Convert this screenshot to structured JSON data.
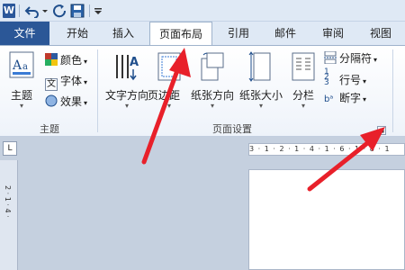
{
  "tabs": {
    "file": "文件",
    "home": "开始",
    "insert": "插入",
    "page_layout": "页面布局",
    "references": "引用",
    "mailings": "邮件",
    "review": "审阅",
    "view": "视图"
  },
  "ribbon": {
    "themes_group": {
      "label": "主题",
      "themes": "主题",
      "colors": "颜色",
      "fonts": "字体",
      "effects": "效果"
    },
    "page_setup_group": {
      "label": "页面设置",
      "text_direction": "文字方向",
      "margins": "页边距",
      "orientation": "纸张方向",
      "size": "纸张大小",
      "columns": "分栏",
      "breaks": "分隔符",
      "line_numbers": "行号",
      "hyphenation": "断字"
    }
  },
  "ruler": {
    "horizontal_ticks": "3 · 1 · 2 · 1 · 4 · 1 · 6 · 1 · 8 · 1",
    "vertical_ticks": "2 · 1 · 4 ·"
  },
  "colors": {
    "accent_arrow": "#e8202a",
    "file_tab": "#2b5797",
    "ribbon_bg": "#dfe9f5"
  },
  "icons": [
    "word-logo-icon",
    "undo-icon",
    "redo-icon",
    "save-icon",
    "customize-icon"
  ]
}
